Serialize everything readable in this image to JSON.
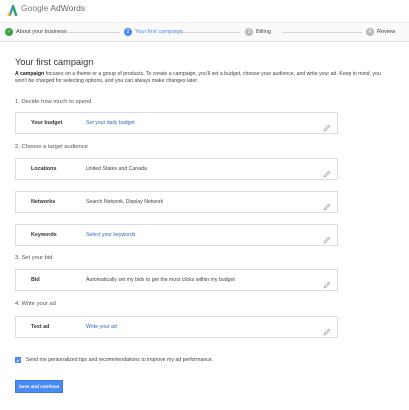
{
  "app": {
    "brand": "Google",
    "product": "AdWords"
  },
  "steps": [
    {
      "label": "About your business",
      "state": "done",
      "marker": "✓"
    },
    {
      "label": "Your first campaign",
      "state": "active",
      "marker": "2"
    },
    {
      "label": "Billing",
      "state": "todo",
      "marker": "3"
    },
    {
      "label": "Review",
      "state": "todo",
      "marker": "4"
    }
  ],
  "page": {
    "title": "Your first campaign",
    "intro_bold": "A campaign",
    "intro_rest": " focuses on a theme or a group of products. To create a campaign, you'll set a budget, choose your audience, and write your ad. Keep in mind, you won't be charged for selecting options, and you can always make changes later."
  },
  "sections": {
    "budget": "1. Decide how much to spend",
    "audience": "2. Choose a target audience",
    "bid": "3. Set your bid",
    "ad": "4. Write your ad"
  },
  "cards": {
    "budget": {
      "label": "Your budget",
      "value": "Set your daily budget"
    },
    "locations": {
      "label": "Locations",
      "value": "United States and Canada"
    },
    "networks": {
      "label": "Networks",
      "value": "Search Network, Display Network"
    },
    "keywords": {
      "label": "Keywords",
      "value": "Select your keywords"
    },
    "bid": {
      "label": "Bid",
      "value": "Automatically set my bids to get the most clicks within my budget"
    },
    "textad": {
      "label": "Text ad",
      "value": "Write your ad"
    }
  },
  "tips_option": {
    "label": "Send me personalized tips and recommendations to improve my ad performance.",
    "checked": true
  },
  "save_button": "Save and continue",
  "colors": {
    "accent": "#4a8af4",
    "done": "#3aa046",
    "link": "#2a66c4"
  }
}
